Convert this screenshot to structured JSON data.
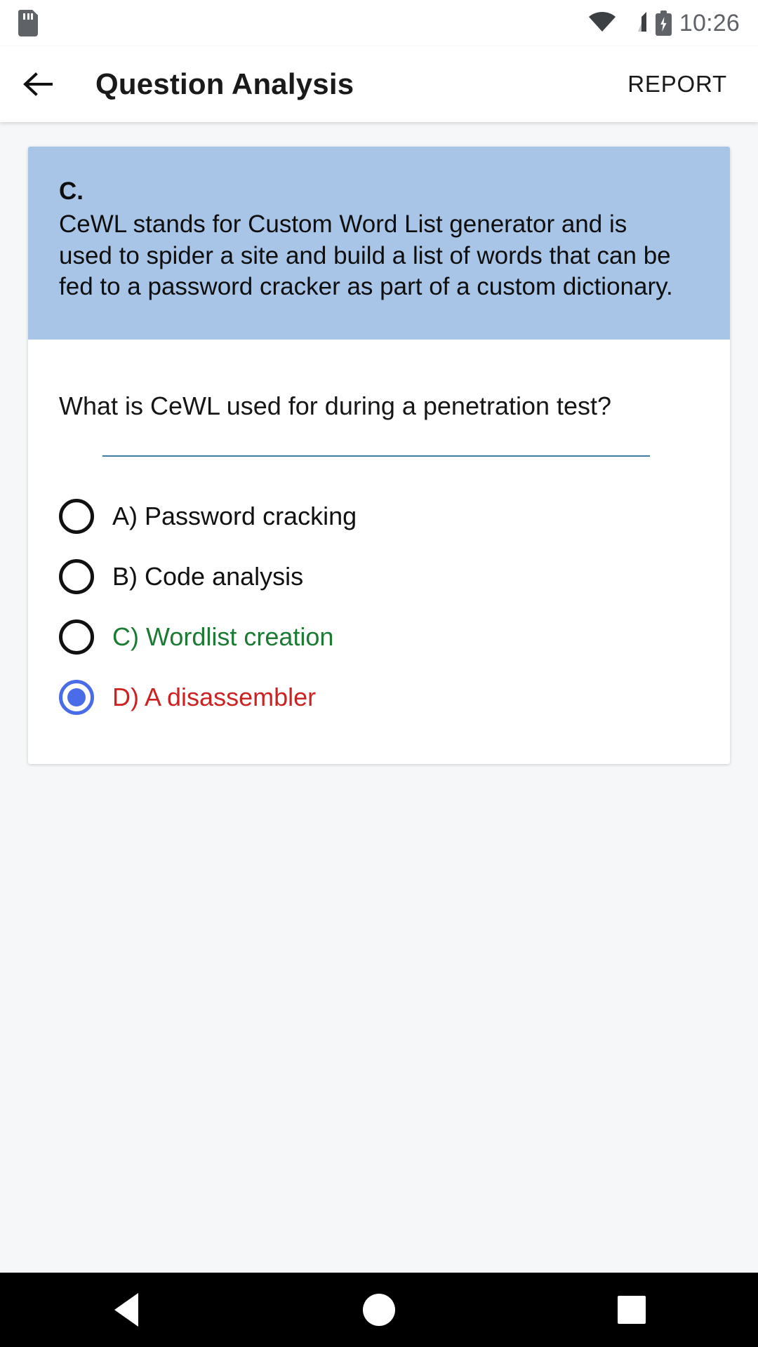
{
  "status_bar": {
    "sd_card_icon": "sd-card-icon",
    "wifi_icon": "wifi-icon",
    "signal_icon": "cellular-signal-icon",
    "battery_icon": "battery-charging-icon",
    "time": "10:26"
  },
  "app_bar": {
    "back_icon": "arrow-left-icon",
    "title": "Question Analysis",
    "report_label": "REPORT"
  },
  "explanation": {
    "letter": "C.",
    "text": "CeWL stands for Custom Word List generator and is used to spider a site and build a list of words that can be fed to a password cracker as part of a custom dictionary.",
    "background_color": "#a8c5e8"
  },
  "question": {
    "text": "What is CeWL used for during a penetration test?",
    "divider_color": "#3b7ea1"
  },
  "options": [
    {
      "label": "A) Password cracking",
      "color": "#111111",
      "selected": false
    },
    {
      "label": "B) Code analysis",
      "color": "#111111",
      "selected": false
    },
    {
      "label": "C) Wordlist creation",
      "color": "#1b7a33",
      "selected": false
    },
    {
      "label": "D) A disassembler",
      "color": "#cc2222",
      "selected": true
    }
  ],
  "nav_bar": {
    "back_icon": "triangle-back-icon",
    "home_icon": "circle-home-icon",
    "recents_icon": "square-recents-icon"
  },
  "colors": {
    "correct_green": "#1b7a33",
    "wrong_red": "#cc2222",
    "selected_blue": "#4a6ce8",
    "page_background": "#f6f7f8"
  }
}
